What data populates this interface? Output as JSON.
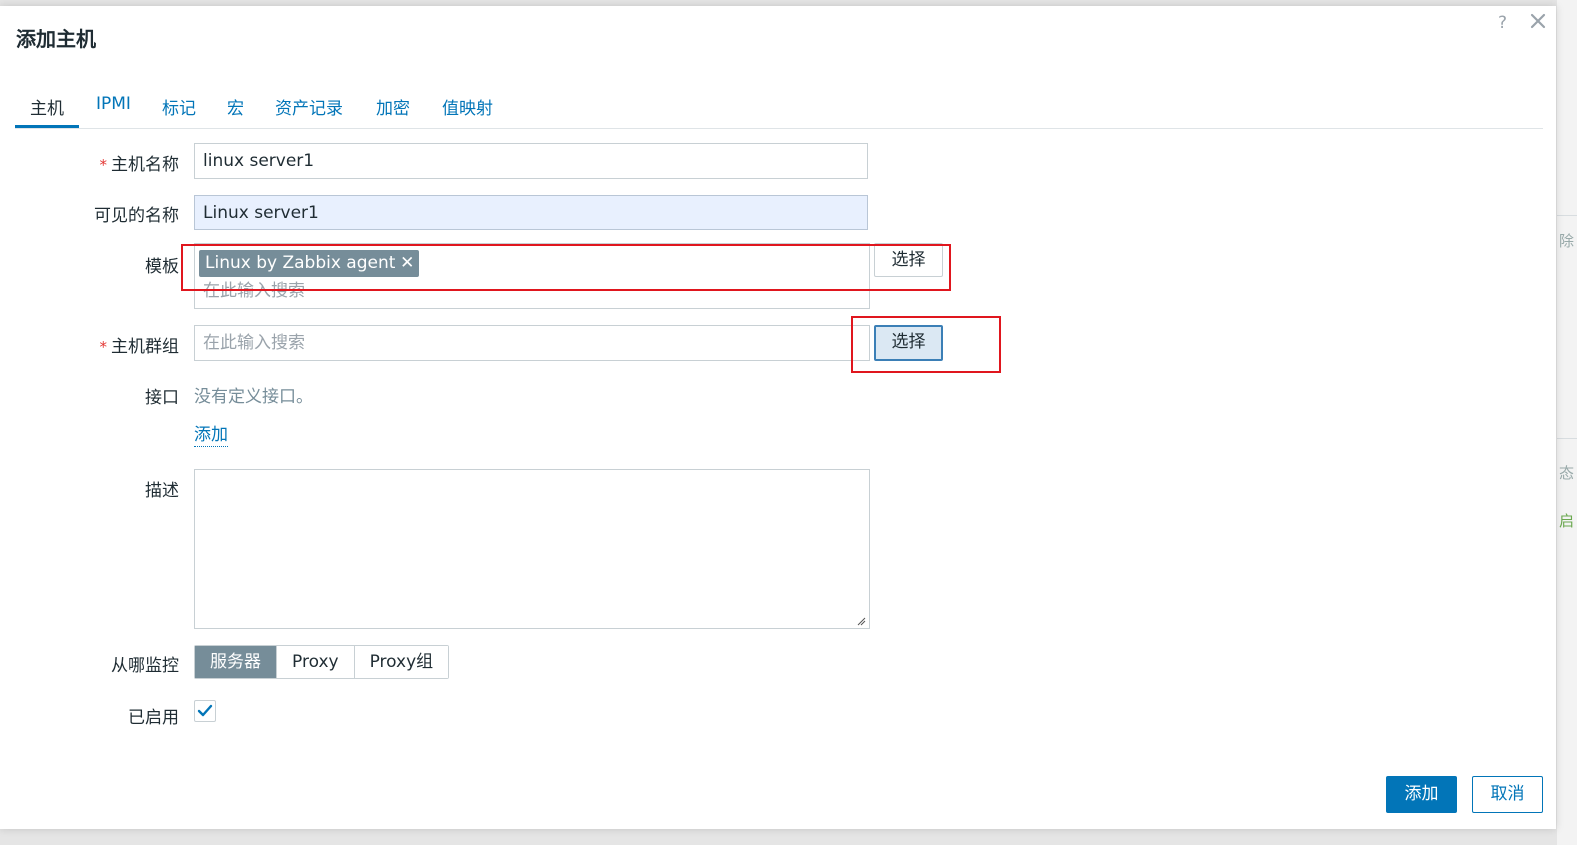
{
  "dialog": {
    "title": "添加主机",
    "help_icon": "?",
    "close_icon": "close-icon"
  },
  "tabs": [
    {
      "label": "主机",
      "active": true
    },
    {
      "label": "IPMI"
    },
    {
      "label": "标记"
    },
    {
      "label": "宏"
    },
    {
      "label": "资产记录"
    },
    {
      "label": "加密"
    },
    {
      "label": "值映射"
    }
  ],
  "form": {
    "required_mark": "*",
    "host_name": {
      "label": "主机名称",
      "value": "linux server1"
    },
    "visible_name": {
      "label": "可见的名称",
      "value": "Linux server1"
    },
    "templates": {
      "label": "模板",
      "selected": [
        "Linux by Zabbix agent"
      ],
      "remove_icon": "✕",
      "placeholder": "在此输入搜索",
      "select_button": "选择"
    },
    "host_groups": {
      "label": "主机群组",
      "placeholder": "在此输入搜索",
      "select_button": "选择"
    },
    "interfaces": {
      "label": "接口",
      "empty_text": "没有定义接口。",
      "add_link": "添加"
    },
    "description": {
      "label": "描述",
      "value": ""
    },
    "monitored_by": {
      "label": "从哪监控",
      "options": [
        "服务器",
        "Proxy",
        "Proxy组"
      ],
      "selected": "服务器"
    },
    "enabled": {
      "label": "已启用",
      "checked": true
    }
  },
  "footer": {
    "add_button": "添加",
    "cancel_button": "取消"
  },
  "background": {
    "fragments": [
      "除",
      "态",
      "启"
    ]
  },
  "colors": {
    "accent": "#0275b8",
    "highlight_box": "#e0161e",
    "tag_bg": "#768d99",
    "required": "#e33734"
  }
}
